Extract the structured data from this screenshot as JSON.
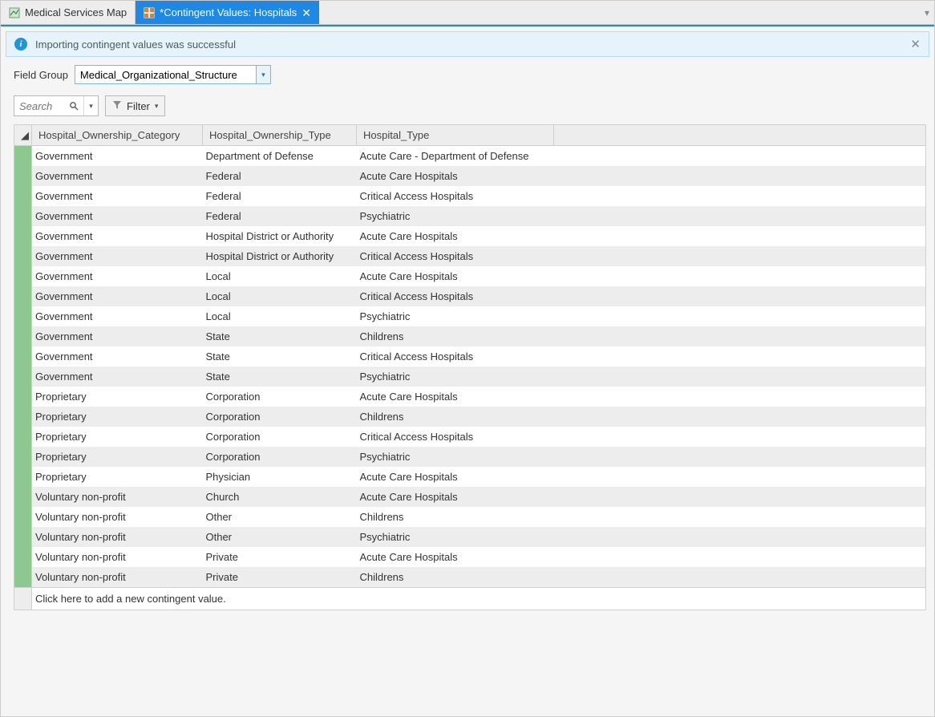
{
  "tabs": [
    {
      "label": "Medical Services Map"
    },
    {
      "label": "*Contingent Values: Hospitals"
    }
  ],
  "infoBar": {
    "message": "Importing contingent values was successful"
  },
  "fieldGroup": {
    "label": "Field Group",
    "value": "Medical_Organizational_Structure"
  },
  "toolbar": {
    "searchPlaceholder": "Search",
    "filterLabel": "Filter"
  },
  "table": {
    "headers": [
      "Hospital_Ownership_Category",
      "Hospital_Ownership_Type",
      "Hospital_Type"
    ],
    "rows": [
      [
        "Government",
        "Department of Defense",
        "Acute Care - Department of Defense"
      ],
      [
        "Government",
        "Federal",
        "Acute Care Hospitals"
      ],
      [
        "Government",
        "Federal",
        "Critical Access Hospitals"
      ],
      [
        "Government",
        "Federal",
        "Psychiatric"
      ],
      [
        "Government",
        "Hospital District or Authority",
        "Acute Care Hospitals"
      ],
      [
        "Government",
        "Hospital District or Authority",
        "Critical Access Hospitals"
      ],
      [
        "Government",
        "Local",
        "Acute Care Hospitals"
      ],
      [
        "Government",
        "Local",
        "Critical Access Hospitals"
      ],
      [
        "Government",
        "Local",
        "Psychiatric"
      ],
      [
        "Government",
        "State",
        "Childrens"
      ],
      [
        "Government",
        "State",
        "Critical Access Hospitals"
      ],
      [
        "Government",
        "State",
        "Psychiatric"
      ],
      [
        "Proprietary",
        "Corporation",
        "Acute Care Hospitals"
      ],
      [
        "Proprietary",
        "Corporation",
        "Childrens"
      ],
      [
        "Proprietary",
        "Corporation",
        "Critical Access Hospitals"
      ],
      [
        "Proprietary",
        "Corporation",
        "Psychiatric"
      ],
      [
        "Proprietary",
        "Physician",
        "Acute Care Hospitals"
      ],
      [
        "Voluntary non-profit",
        "Church",
        "Acute Care Hospitals"
      ],
      [
        "Voluntary non-profit",
        "Other",
        "Childrens"
      ],
      [
        "Voluntary non-profit",
        "Other",
        "Psychiatric"
      ],
      [
        "Voluntary non-profit",
        "Private",
        "Acute Care Hospitals"
      ],
      [
        "Voluntary non-profit",
        "Private",
        "Childrens"
      ]
    ],
    "addRowLabel": "Click here to add a new contingent value."
  }
}
